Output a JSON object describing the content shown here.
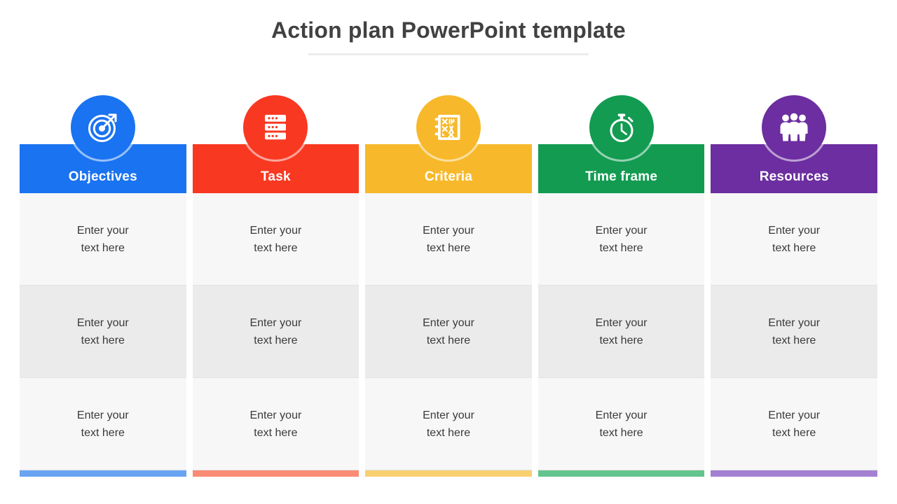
{
  "slide": {
    "title": "Action plan PowerPoint template",
    "background_color": "#ffffff",
    "title_color": "#414141",
    "rule_color": "#ececec"
  },
  "table": {
    "rows": 3,
    "cell_text": "Enter your\ntext here",
    "row_colors": [
      "#f7f7f7",
      "#ebebeb",
      "#f7f7f7"
    ],
    "columns": [
      {
        "header": "Objectives",
        "icon": "target-icon",
        "color": "#1a73f0",
        "footer_color": "#68a4f2"
      },
      {
        "header": "Task",
        "icon": "task-list-icon",
        "color": "#f93822",
        "footer_color": "#fa8b74"
      },
      {
        "header": "Criteria",
        "icon": "checklist-notepad-icon",
        "color": "#f7b92b",
        "footer_color": "#f8d070"
      },
      {
        "header": "Time frame",
        "icon": "stopwatch-icon",
        "color": "#129b51",
        "footer_color": "#63c48d"
      },
      {
        "header": "Resources",
        "icon": "people-group-icon",
        "color": "#6c2ea0",
        "footer_color": "#a480d2"
      }
    ],
    "cells": [
      [
        "Enter your\ntext here",
        "Enter your\ntext here",
        "Enter your\ntext here",
        "Enter your\ntext here",
        "Enter your\ntext here"
      ],
      [
        "Enter your\ntext here",
        "Enter your\ntext here",
        "Enter your\ntext here",
        "Enter your\ntext here",
        "Enter your\ntext here"
      ],
      [
        "Enter your\ntext here",
        "Enter your\ntext here",
        "Enter your\ntext here",
        "Enter your\ntext here",
        "Enter your\ntext here"
      ]
    ]
  }
}
